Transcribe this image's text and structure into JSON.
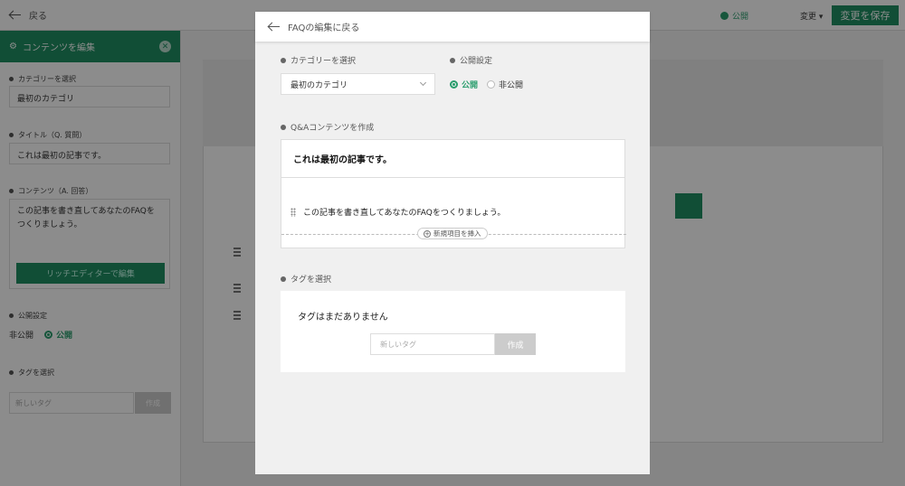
{
  "background": {
    "topbar": {
      "back_label": "戻る",
      "status_label": "公開",
      "change_label": "変更 ▾",
      "save_label": "変更を保存"
    },
    "sidebar": {
      "header": "コンテンツを編集",
      "category_label": "カテゴリーを選択",
      "category_value": "最初のカテゴリ",
      "title_label": "タイトル（Q. 質問）",
      "title_value": "これは最初の記事です。",
      "content_label": "コンテンツ（A. 回答）",
      "content_value": "この記事を書き直してあなたのFAQをつくりましょう。",
      "rich_editor_button": "リッチエディターで編集",
      "publish_label": "公開設定",
      "private_option": "非公開",
      "public_option": "公開",
      "tag_label": "タグを選択",
      "tag_placeholder": "新しいタグ",
      "tag_button": "作成"
    }
  },
  "modal": {
    "back_label": "FAQの編集に戻る",
    "category": {
      "label": "カテゴリーを選択",
      "selected": "最初のカテゴリ"
    },
    "publish": {
      "label": "公開設定",
      "options": [
        "公開",
        "非公開"
      ],
      "selected": "公開"
    },
    "qa": {
      "label": "Q&Aコンテンツを作成",
      "question": "これは最初の記事です。",
      "answer": "この記事を書き直してあなたのFAQをつくりましょう。",
      "insert_label": "新規項目を挿入"
    },
    "tags": {
      "label": "タグを選択",
      "empty_message": "タグはまだありません",
      "input_placeholder": "新しいタグ",
      "create_button": "作成"
    }
  },
  "colors": {
    "accent": "#1f8f63",
    "radio_active": "#2a9d6d",
    "disabled": "#cccccc"
  }
}
